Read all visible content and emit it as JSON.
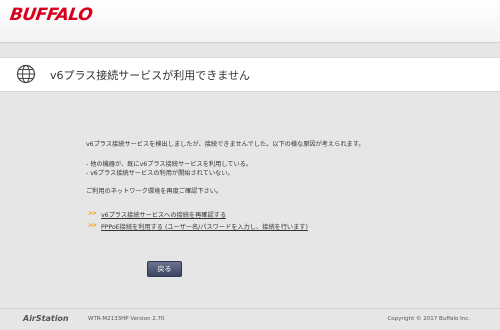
{
  "brand": {
    "logo_text": "BUFFALO",
    "color": "#d6001c"
  },
  "header": {
    "title": "v6プラス接続サービスが利用できません",
    "icon": "globe-icon"
  },
  "message": {
    "line1": "v6プラス接続サービスを検出しましたが、接続できませんでした。以下の様な原因が考えられます。",
    "cause1": "- 他の機器が、既にv6プラス接続サービスを利用している。",
    "cause2": "- v6プラス接続サービスの利用が開始されていない。",
    "check": "ご利用のネットワーク環境を再度ご確認下さい。"
  },
  "links": [
    {
      "label": "v6プラス接続サービスへの接続を再確認する"
    },
    {
      "label": "PPPoE接続を利用する (ユーザー名/パスワードを入力し、接続を行います)"
    }
  ],
  "back_button": {
    "label": "戻る"
  },
  "footer": {
    "product": "AirStation",
    "model": "WTR-M2133HP   Version 2.70",
    "copyright": "Copyright © 2017 Buffalo Inc."
  },
  "colors": {
    "link_arrow": "#f0a000",
    "button": "#4a5372"
  }
}
